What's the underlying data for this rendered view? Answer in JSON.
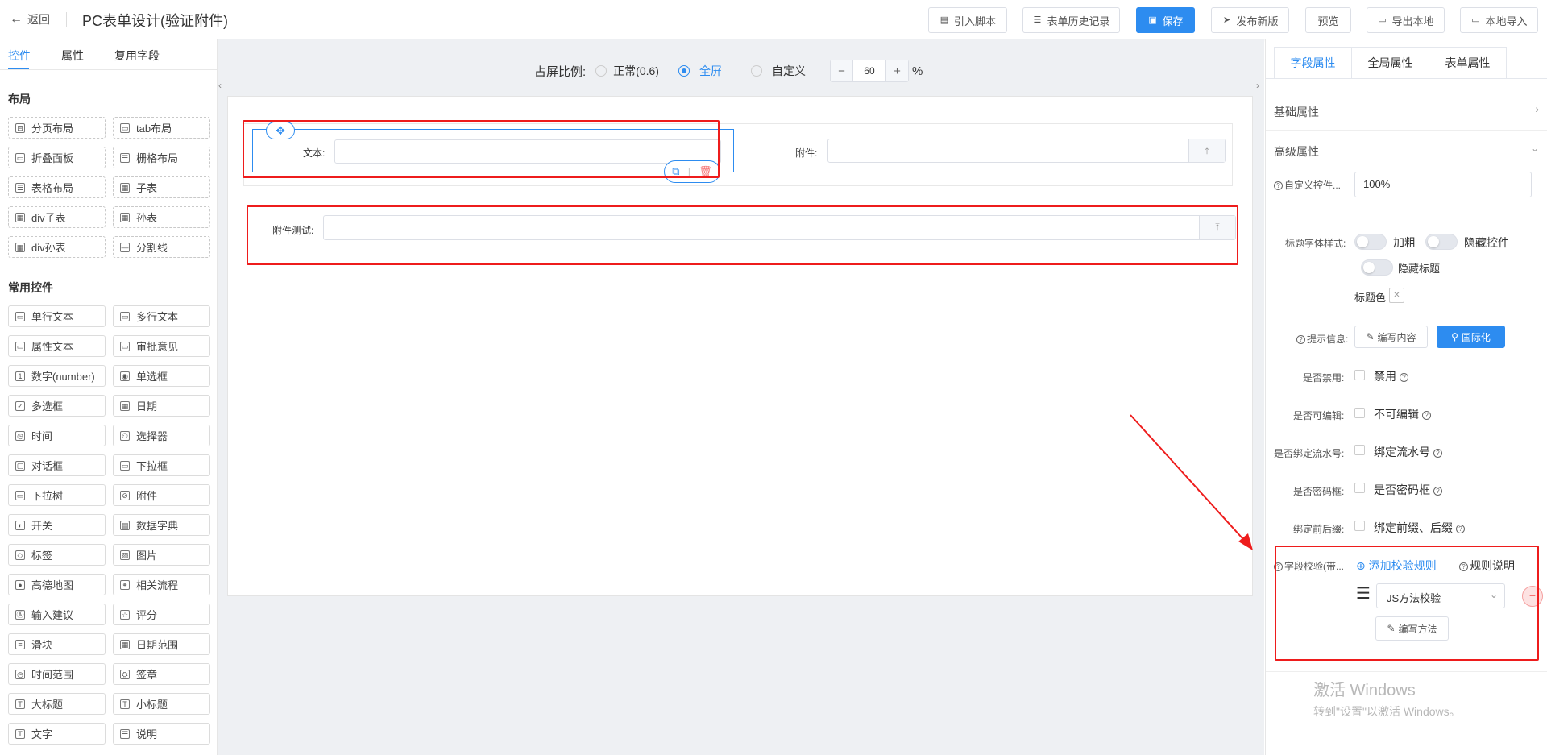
{
  "topbar": {
    "back_label": "返回",
    "title": "PC表单设计(验证附件)",
    "buttons": {
      "import_script": "引入脚本",
      "history": "表单历史记录",
      "save": "保存",
      "publish": "发布新版",
      "preview": "预览",
      "export": "导出本地",
      "import_local": "本地导入"
    }
  },
  "left": {
    "tabs": [
      "控件",
      "属性",
      "复用字段"
    ],
    "layout_title": "布局",
    "layout_items": [
      "分页布局",
      "tab布局",
      "折叠面板",
      "栅格布局",
      "表格布局",
      "子表",
      "div子表",
      "孙表",
      "div孙表",
      "分割线"
    ],
    "common_title": "常用控件",
    "common_items": [
      "单行文本",
      "多行文本",
      "属性文本",
      "审批意见",
      "数字(number)",
      "单选框",
      "多选框",
      "日期",
      "时间",
      "选择器",
      "对话框",
      "下拉框",
      "下拉树",
      "附件",
      "开关",
      "数据字典",
      "标签",
      "图片",
      "高德地图",
      "相关流程",
      "输入建议",
      "评分",
      "滑块",
      "日期范围",
      "时间范围",
      "签章",
      "大标题",
      "小标题",
      "文字",
      "说明"
    ]
  },
  "center": {
    "ratio_label": "占屏比例:",
    "ratio_options": [
      "正常(0.6)",
      "全屏",
      "自定义"
    ],
    "ratio_selected": "全屏",
    "custom_value": "60",
    "percent": "%",
    "minus": "−",
    "plus": "+",
    "fields": {
      "text_label": "文本:",
      "attach_label": "附件:",
      "attach_test_label": "附件测试:"
    }
  },
  "right": {
    "tabs": [
      "字段属性",
      "全局属性",
      "表单属性"
    ],
    "basic_attr": "基础属性",
    "advanced_attr": "高级属性",
    "custom_ctrl_label": "自定义控件...",
    "custom_ctrl_value": "100%",
    "title_font_label": "标题字体样式:",
    "bold": "加粗",
    "hide_ctrl": "隐藏控件",
    "hide_title": "隐藏标题",
    "title_color": "标题色",
    "hint_label": "提示信息:",
    "edit_content": "编写内容",
    "i18n": "国际化",
    "disabled_label": "是否禁用:",
    "disabled_text": "禁用",
    "editable_label": "是否可编辑:",
    "editable_text": "不可编辑",
    "serial_label": "是否绑定流水号:",
    "serial_text": "绑定流水号",
    "password_label": "是否密码框:",
    "password_text": "是否密码框",
    "prefix_label": "绑定前后缀:",
    "prefix_text": "绑定前缀、后缀",
    "validate_label": "字段校验(带...",
    "add_rule": "添加校验规则",
    "rule_desc": "规则说明",
    "rule_select": "JS方法校验",
    "write_method": "编写方法"
  },
  "watermark": {
    "line1": "激活 Windows",
    "line2": "转到\"设置\"以激活 Windows。"
  },
  "colors": {
    "accent": "#2d8cf0",
    "highlight_red": "#ee1c1c"
  }
}
